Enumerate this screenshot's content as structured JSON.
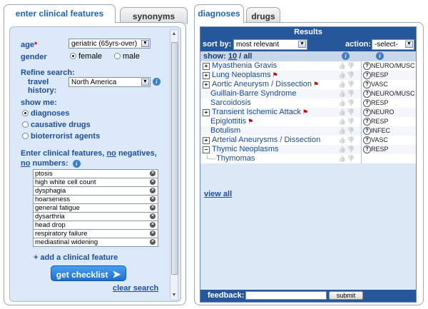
{
  "left_tabs": [
    "enter clinical features",
    "synonyms"
  ],
  "right_tabs": [
    "diagnoses",
    "drugs"
  ],
  "form": {
    "age_label": "age",
    "age_required": "*",
    "age_value": "geriatric (65yrs-over)",
    "gender_label": "gender",
    "gender_options": [
      "female",
      "male"
    ],
    "gender_selected": "female",
    "refine_label": "Refine search:",
    "travel_label": "travel history:",
    "travel_value": "North America",
    "show_me_label": "show me:",
    "show_options": [
      "diagnoses",
      "causative drugs",
      "bioterrorist agents"
    ],
    "show_selected": "diagnoses",
    "enter_label_parts": [
      "Enter clinical features, ",
      "no",
      " negatives,",
      "no",
      " numbers:"
    ],
    "features": [
      "ptosis",
      "high white cell count",
      "dysphagia",
      "hoarseness",
      "general fatigue",
      "dysarthria",
      "head drop",
      "respiratory failure",
      "mediastinal widening"
    ],
    "add_feature": "+ add a clinical feature",
    "get_checklist": "get checklist",
    "clear_search": "clear search"
  },
  "results": {
    "title": "Results",
    "sort_by_label": "sort by:",
    "sort_by_value": "most relevant",
    "action_label": "action:",
    "action_value": "-select-",
    "show_prefix": "show: ",
    "show_count": "10",
    "show_suffix": " / all",
    "rows": [
      {
        "name": "Myasthenia Gravis",
        "expand": "+",
        "flag": false,
        "category": "NEURO/MUSC"
      },
      {
        "name": "Lung Neoplasms",
        "expand": "+",
        "flag": true,
        "category": "RESP"
      },
      {
        "name": "Aortic Aneurysm / Dissection",
        "expand": "+",
        "flag": true,
        "category": "VASC"
      },
      {
        "name": "Guillain-Barre Syndrome",
        "expand": "",
        "flag": false,
        "category": "NEURO/MUSC"
      },
      {
        "name": "Sarcoidosis",
        "expand": "",
        "flag": false,
        "category": "RESP"
      },
      {
        "name": "Transient Ischemic Attack",
        "expand": "+",
        "flag": true,
        "category": "NEURO"
      },
      {
        "name": "Epiglottitis",
        "expand": "",
        "flag": true,
        "category": "RESP"
      },
      {
        "name": "Botulism",
        "expand": "",
        "flag": false,
        "category": "INFEC"
      },
      {
        "name": "Arterial Aneurysms / Dissection",
        "expand": "+",
        "flag": false,
        "category": "VASC"
      },
      {
        "name": "Thymic Neoplasms",
        "expand": "−",
        "flag": false,
        "category": "RESP"
      },
      {
        "name": "Thymomas",
        "expand": "",
        "flag": false,
        "category": ""
      }
    ],
    "view_all": "view all",
    "feedback_label": "feedback:",
    "submit": "submit"
  }
}
